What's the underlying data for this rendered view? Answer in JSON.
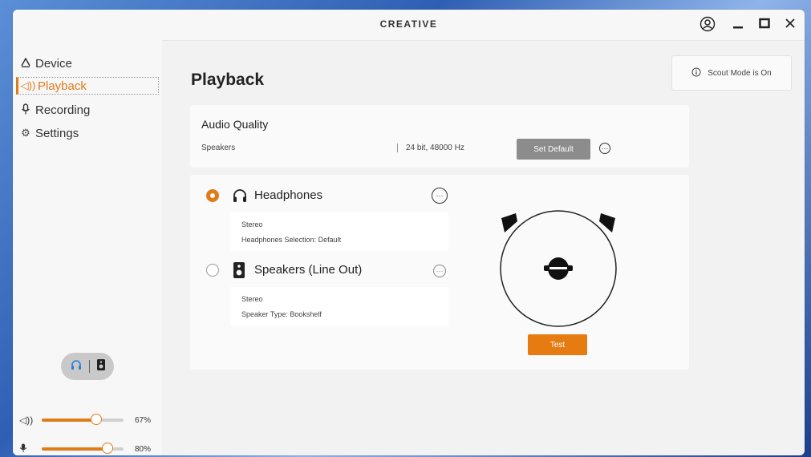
{
  "app": {
    "brand": "CREATIVE"
  },
  "sidebar": {
    "items": [
      {
        "label": "Device",
        "icon": "device-icon"
      },
      {
        "label": "Playback",
        "icon": "speaker-icon",
        "active": true
      },
      {
        "label": "Recording",
        "icon": "microphone-icon"
      },
      {
        "label": "Settings",
        "icon": "gear-icon"
      }
    ],
    "output_toggle": {
      "options": [
        "headphones",
        "speakers"
      ],
      "selected": "headphones"
    },
    "volume": {
      "playback_label": "67%",
      "playback_value": 67,
      "mic_label": "80%",
      "mic_value": 80
    }
  },
  "main": {
    "title": "Playback",
    "scout": "Scout Mode is On",
    "audio_quality": {
      "title": "Audio Quality",
      "device": "Speakers",
      "format": "24 bit, 48000 Hz",
      "set_default": "Set Default"
    },
    "devices": [
      {
        "name": "Headphones",
        "selected": true,
        "line1": "Stereo",
        "line2": "Headphones Selection: Default"
      },
      {
        "name": "Speakers (Line Out)",
        "selected": false,
        "line1": "Stereo",
        "line2": "Speaker Type: Bookshelf"
      }
    ],
    "test_button": "Test"
  },
  "colors": {
    "accent": "#e07b1a",
    "button_gray": "#8c8c8c"
  }
}
